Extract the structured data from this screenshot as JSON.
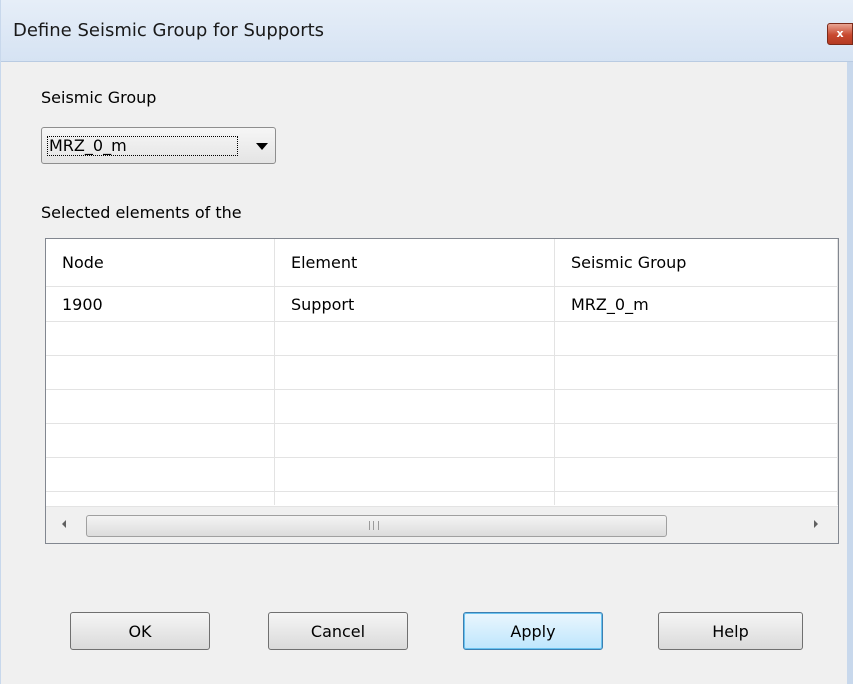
{
  "window": {
    "title": "Define Seismic Group for Supports",
    "close_label": "x"
  },
  "seismic_group": {
    "label": "Seismic Group",
    "selected": "MRZ_0_m"
  },
  "selection": {
    "label": "Selected elements of the"
  },
  "table": {
    "headers": [
      "Node",
      "Element",
      "Seismic Group"
    ],
    "rows": [
      [
        "1900",
        "Support",
        "MRZ_0_m"
      ]
    ]
  },
  "buttons": {
    "ok": "OK",
    "cancel": "Cancel",
    "apply": "Apply",
    "help": "Help"
  },
  "colors": {
    "default_button_border": "#3c7fb1",
    "close_button": "#c8492f"
  }
}
